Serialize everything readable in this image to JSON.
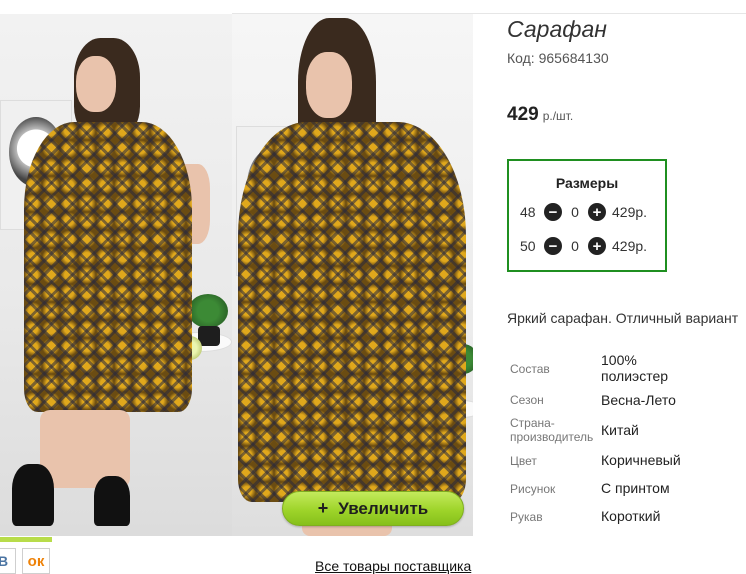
{
  "product": {
    "title": "Сарафан",
    "code_label": "Код:",
    "code": "965684130",
    "price": "429",
    "price_unit": "р./шт.",
    "description": "Яркий сарафан. Отличный вариант"
  },
  "sizes": {
    "title": "Размеры",
    "items": [
      {
        "size": "48",
        "qty": "0",
        "price": "429р."
      },
      {
        "size": "50",
        "qty": "0",
        "price": "429р."
      }
    ]
  },
  "attributes": [
    {
      "label": "Состав",
      "value": "100% полиэстер"
    },
    {
      "label": "Сезон",
      "value": "Весна-Лето"
    },
    {
      "label": "Страна-производитель",
      "value": "Китай"
    },
    {
      "label": "Цвет",
      "value": "Коричневый"
    },
    {
      "label": "Рисунок",
      "value": "С принтом"
    },
    {
      "label": "Рукав",
      "value": "Короткий"
    }
  ],
  "gallery": {
    "zoom_label": "Увеличить",
    "zoom_icon": "plus-icon"
  },
  "footer": {
    "supplier_link": "Все товары поставщика",
    "social": [
      {
        "name": "vk-icon",
        "glyph": "В"
      },
      {
        "name": "ok-icon",
        "glyph": "ок"
      }
    ]
  },
  "colors": {
    "sizes_border": "#1f8f20",
    "zoom_button": "#9ed42a",
    "accent_strip": "#b8dc4a"
  }
}
